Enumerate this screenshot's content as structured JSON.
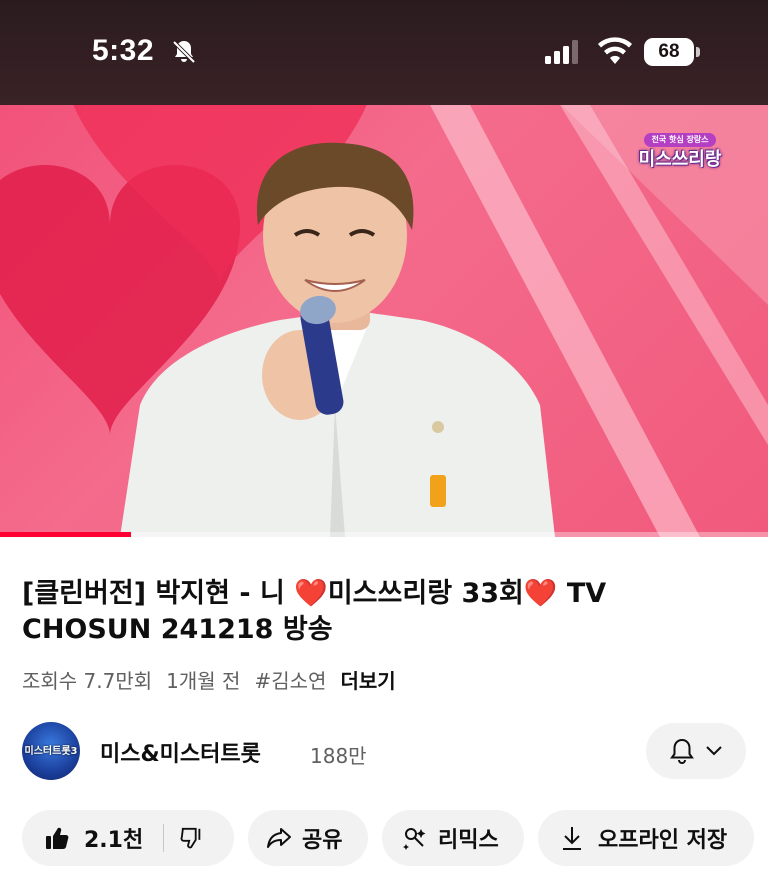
{
  "status_bar": {
    "time": "5:32",
    "battery": "68",
    "icons": [
      "mute-bell-icon",
      "signal-icon",
      "wifi-icon",
      "battery-icon"
    ]
  },
  "video": {
    "channel_bug_main": "미스쓰리랑",
    "channel_bug_sub": "전국 핫심 장랑스",
    "progress": 0.17,
    "accent": "#ff0033"
  },
  "info": {
    "title_part1": "[클린버전] 박지현 - 니 ",
    "title_heart1": "❤️",
    "title_part2": "미스쓰리랑 33회",
    "title_heart2": "❤️",
    "title_part3": " TV CHOSUN 241218 방송",
    "views": "조회수 7.7만회",
    "age": "1개월 전",
    "hashtag": "#김소연",
    "more": "더보기"
  },
  "channel": {
    "avatar_text": "미스터트롯3",
    "name": "미스&미스터트롯",
    "subscribers": "188만",
    "icons": [
      "bell-icon",
      "chevron-down-icon"
    ]
  },
  "actions": {
    "like_count": "2.1천",
    "share": "공유",
    "remix": "리믹스",
    "offline": "오프라인 저장",
    "icons": [
      "thumbs-up-icon",
      "thumbs-down-icon",
      "share-icon",
      "remix-icon",
      "download-icon"
    ]
  }
}
